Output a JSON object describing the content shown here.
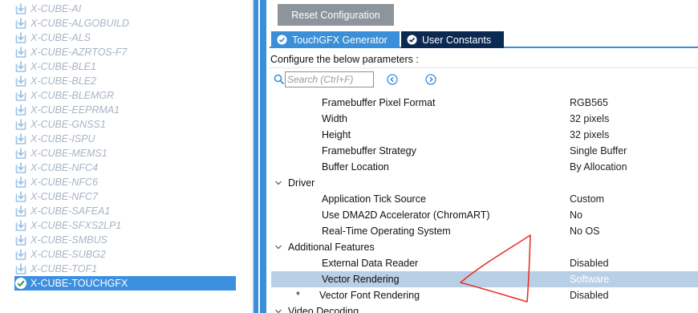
{
  "tree": {
    "items": [
      {
        "label": "X-CUBE-AI",
        "selected": false
      },
      {
        "label": "X-CUBE-ALGOBUILD",
        "selected": false
      },
      {
        "label": "X-CUBE-ALS",
        "selected": false
      },
      {
        "label": "X-CUBE-AZRTOS-F7",
        "selected": false
      },
      {
        "label": "X-CUBE-BLE1",
        "selected": false
      },
      {
        "label": "X-CUBE-BLE2",
        "selected": false
      },
      {
        "label": "X-CUBE-BLEMGR",
        "selected": false
      },
      {
        "label": "X-CUBE-EEPRMA1",
        "selected": false
      },
      {
        "label": "X-CUBE-GNSS1",
        "selected": false
      },
      {
        "label": "X-CUBE-ISPU",
        "selected": false
      },
      {
        "label": "X-CUBE-MEMS1",
        "selected": false
      },
      {
        "label": "X-CUBE-NFC4",
        "selected": false
      },
      {
        "label": "X-CUBE-NFC6",
        "selected": false
      },
      {
        "label": "X-CUBE-NFC7",
        "selected": false
      },
      {
        "label": "X-CUBE-SAFEA1",
        "selected": false
      },
      {
        "label": "X-CUBE-SFXS2LP1",
        "selected": false
      },
      {
        "label": "X-CUBE-SMBUS",
        "selected": false
      },
      {
        "label": "X-CUBE-SUBG2",
        "selected": false
      },
      {
        "label": "X-CUBE-TOF1",
        "selected": false
      },
      {
        "label": "X-CUBE-TOUCHGFX",
        "selected": true
      }
    ]
  },
  "toolbar": {
    "reset_label": "Reset Configuration"
  },
  "tabs": [
    {
      "label": "TouchGFX Generator",
      "icon": "check-circle-icon",
      "active": true
    },
    {
      "label": "User Constants",
      "icon": "check-circle-icon",
      "active": false
    }
  ],
  "configure_label": "Configure the below parameters :",
  "search": {
    "placeholder": "Search (Ctrl+F)",
    "value": ""
  },
  "params": {
    "rows": [
      {
        "kind": "param",
        "name": "Framebuffer Pixel Format",
        "value": "RGB565"
      },
      {
        "kind": "param",
        "name": "Width",
        "value": "32 pixels"
      },
      {
        "kind": "param",
        "name": "Height",
        "value": "32 pixels"
      },
      {
        "kind": "param",
        "name": "Framebuffer Strategy",
        "value": "Single Buffer"
      },
      {
        "kind": "param",
        "name": "Buffer Location",
        "value": "By Allocation"
      },
      {
        "kind": "group",
        "name": "Driver",
        "expanded": true
      },
      {
        "kind": "param",
        "name": "Application Tick Source",
        "value": "Custom"
      },
      {
        "kind": "param",
        "name": "Use DMA2D Accelerator (ChromART)",
        "value": "No"
      },
      {
        "kind": "param",
        "name": "Real-Time Operating System",
        "value": "No OS"
      },
      {
        "kind": "group",
        "name": "Additional Features",
        "expanded": true
      },
      {
        "kind": "param",
        "name": "External Data Reader",
        "value": "Disabled"
      },
      {
        "kind": "param",
        "name": "Vector Rendering",
        "value": "Software",
        "selected": true
      },
      {
        "kind": "param",
        "name": "Vector Font Rendering",
        "value": "Disabled",
        "modified_marker": "*"
      },
      {
        "kind": "group",
        "name": "Video Decoding",
        "expanded": true
      }
    ]
  },
  "colors": {
    "accent": "#3a8fd8",
    "dark_tab": "#0a2a52",
    "button_gray": "#8d949b",
    "selection_row": "#b8cfe6",
    "annotation_red": "#e8342c"
  }
}
